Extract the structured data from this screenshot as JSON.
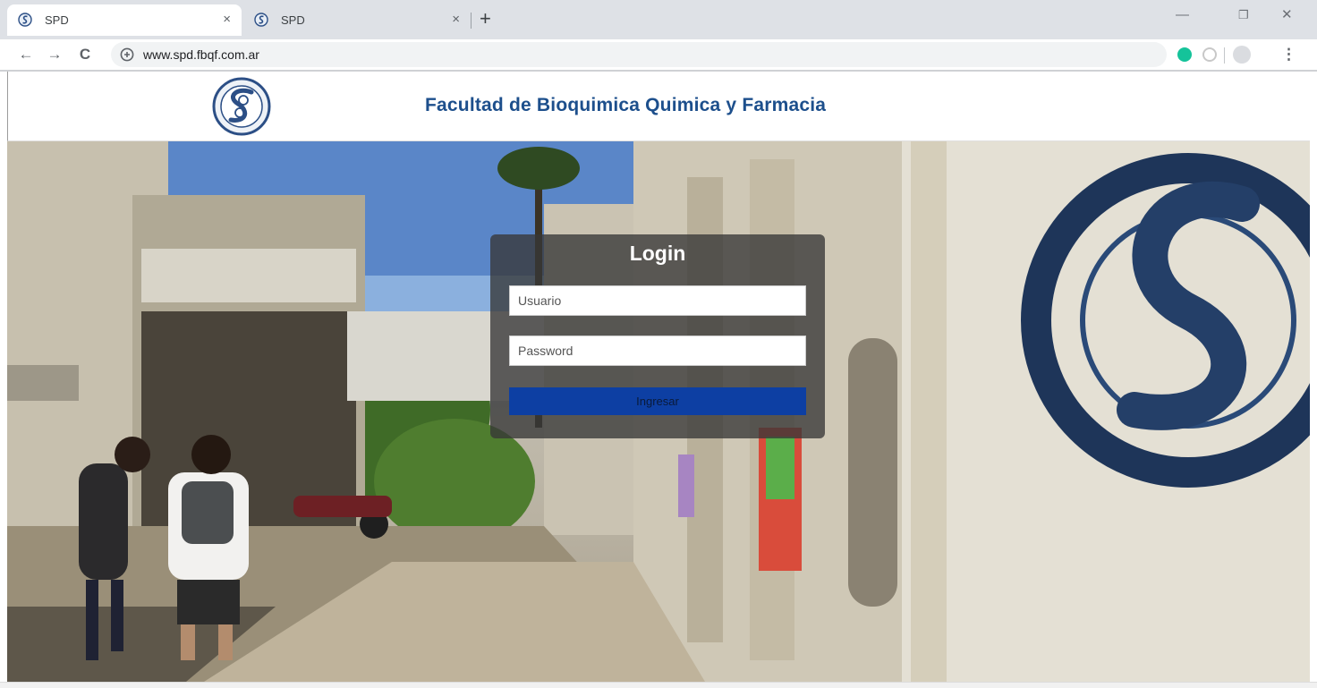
{
  "browser": {
    "tabs": [
      {
        "title": "SPD",
        "close": "×",
        "active": true
      },
      {
        "title": "SPD",
        "close": "×",
        "active": false
      }
    ],
    "new_tab": "+",
    "window_controls": {
      "minimize": "—",
      "restore": "❐",
      "close": "✕"
    },
    "nav": {
      "back": "←",
      "forward": "→",
      "reload": "C"
    },
    "address": "www.spd.fbqf.com.ar",
    "menu": "⋮",
    "extension_colors": {
      "grammarly": "#15c39a",
      "other": "#c8c8c8"
    }
  },
  "page": {
    "header_title": "Facultad de Bioquimica Quimica y Farmacia",
    "brand_color": "#1d4f8c"
  },
  "login": {
    "title": "Login",
    "username_placeholder": "Usuario",
    "password_placeholder": "Password",
    "submit_label": "Ingresar",
    "button_color": "#0d3fa3"
  }
}
